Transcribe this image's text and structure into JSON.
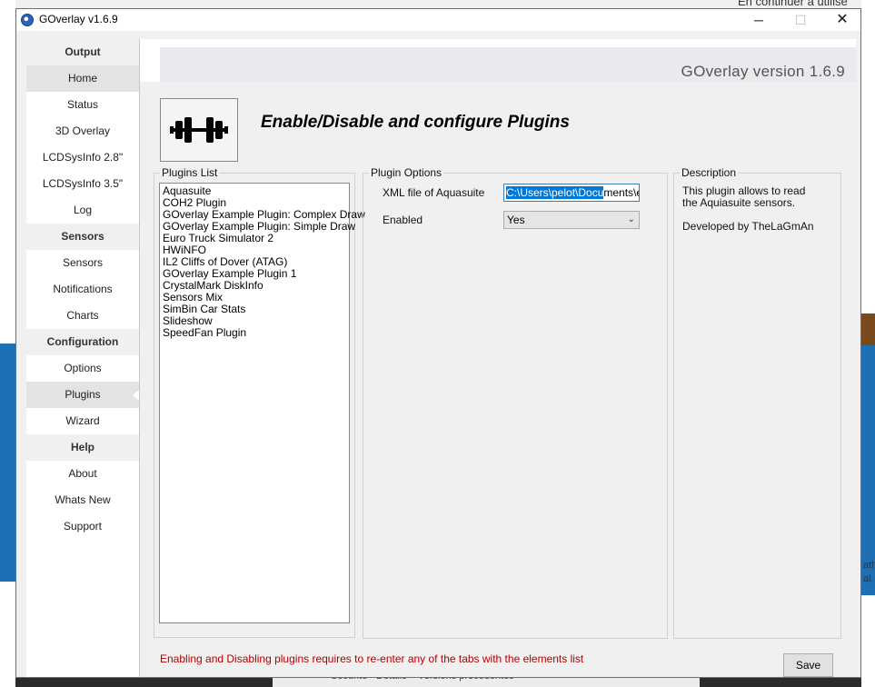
{
  "window": {
    "title": "GOverlay v1.6.9",
    "minimize_glyph": "─",
    "maximize_glyph": "☐",
    "close_glyph": "✕"
  },
  "sidebar": {
    "items": [
      {
        "label": "Output",
        "type": "header"
      },
      {
        "label": "Home",
        "type": "item",
        "active_bg": true
      },
      {
        "label": "Status",
        "type": "item"
      },
      {
        "label": "3D Overlay",
        "type": "item"
      },
      {
        "label": "LCDSysInfo 2.8\"",
        "type": "item"
      },
      {
        "label": "LCDSysInfo 3.5\"",
        "type": "item"
      },
      {
        "label": "Log",
        "type": "item"
      },
      {
        "label": "Sensors",
        "type": "header"
      },
      {
        "label": "Sensors",
        "type": "item"
      },
      {
        "label": "Notifications",
        "type": "item"
      },
      {
        "label": "Charts",
        "type": "item"
      },
      {
        "label": "Configuration",
        "type": "header"
      },
      {
        "label": "Options",
        "type": "item"
      },
      {
        "label": "Plugins",
        "type": "item",
        "selected": true
      },
      {
        "label": "Wizard",
        "type": "item"
      },
      {
        "label": "Help",
        "type": "header"
      },
      {
        "label": "About",
        "type": "item"
      },
      {
        "label": "Whats New",
        "type": "item"
      },
      {
        "label": "Support",
        "type": "item"
      }
    ]
  },
  "header": {
    "version": "GOverlay version 1.6.9",
    "page_title": "Enable/Disable and configure Plugins",
    "logo_icon": "dumbbell-icon"
  },
  "plugins_list": {
    "label": "Plugins List",
    "items": [
      "Aquasuite",
      "COH2 Plugin",
      "GOverlay Example Plugin: Complex Draw",
      "GOverlay Example Plugin: Simple Draw",
      "Euro Truck Simulator 2",
      "HWiNFO",
      "IL2 Cliffs of Dover (ATAG)",
      "GOverlay Example Plugin 1",
      "CrystalMark DiskInfo",
      "Sensors Mix",
      "SimBin Car Stats",
      "Slideshow",
      "SpeedFan Plugin"
    ]
  },
  "plugin_options": {
    "label": "Plugin Options",
    "xml_label": "XML file of Aquasuite",
    "xml_value_selected": "C:\\Users\\pelot\\Docu",
    "xml_value_rest": "ments\\ea",
    "enabled_label": "Enabled",
    "enabled_value": "Yes"
  },
  "description": {
    "label": "Description",
    "line1": "This plugin allows to read the Aquiasuite sensors.",
    "line2": "Developed by TheLaGmAn"
  },
  "footer": {
    "warning": "Enabling and Disabling plugins requires to re-enter any of the tabs with the elements list",
    "save_label": "Save"
  },
  "background": {
    "top_right_text": "En continuer à utilise",
    "bottom_tabs": [
      "Sécurité",
      "Détails",
      "Versions précédentes"
    ],
    "right_edge_1": "ath",
    "right_edge_2": "al."
  },
  "colors": {
    "warning": "#b00000",
    "selection": "#0078d7",
    "accent_blue": "#1f6fb5"
  }
}
